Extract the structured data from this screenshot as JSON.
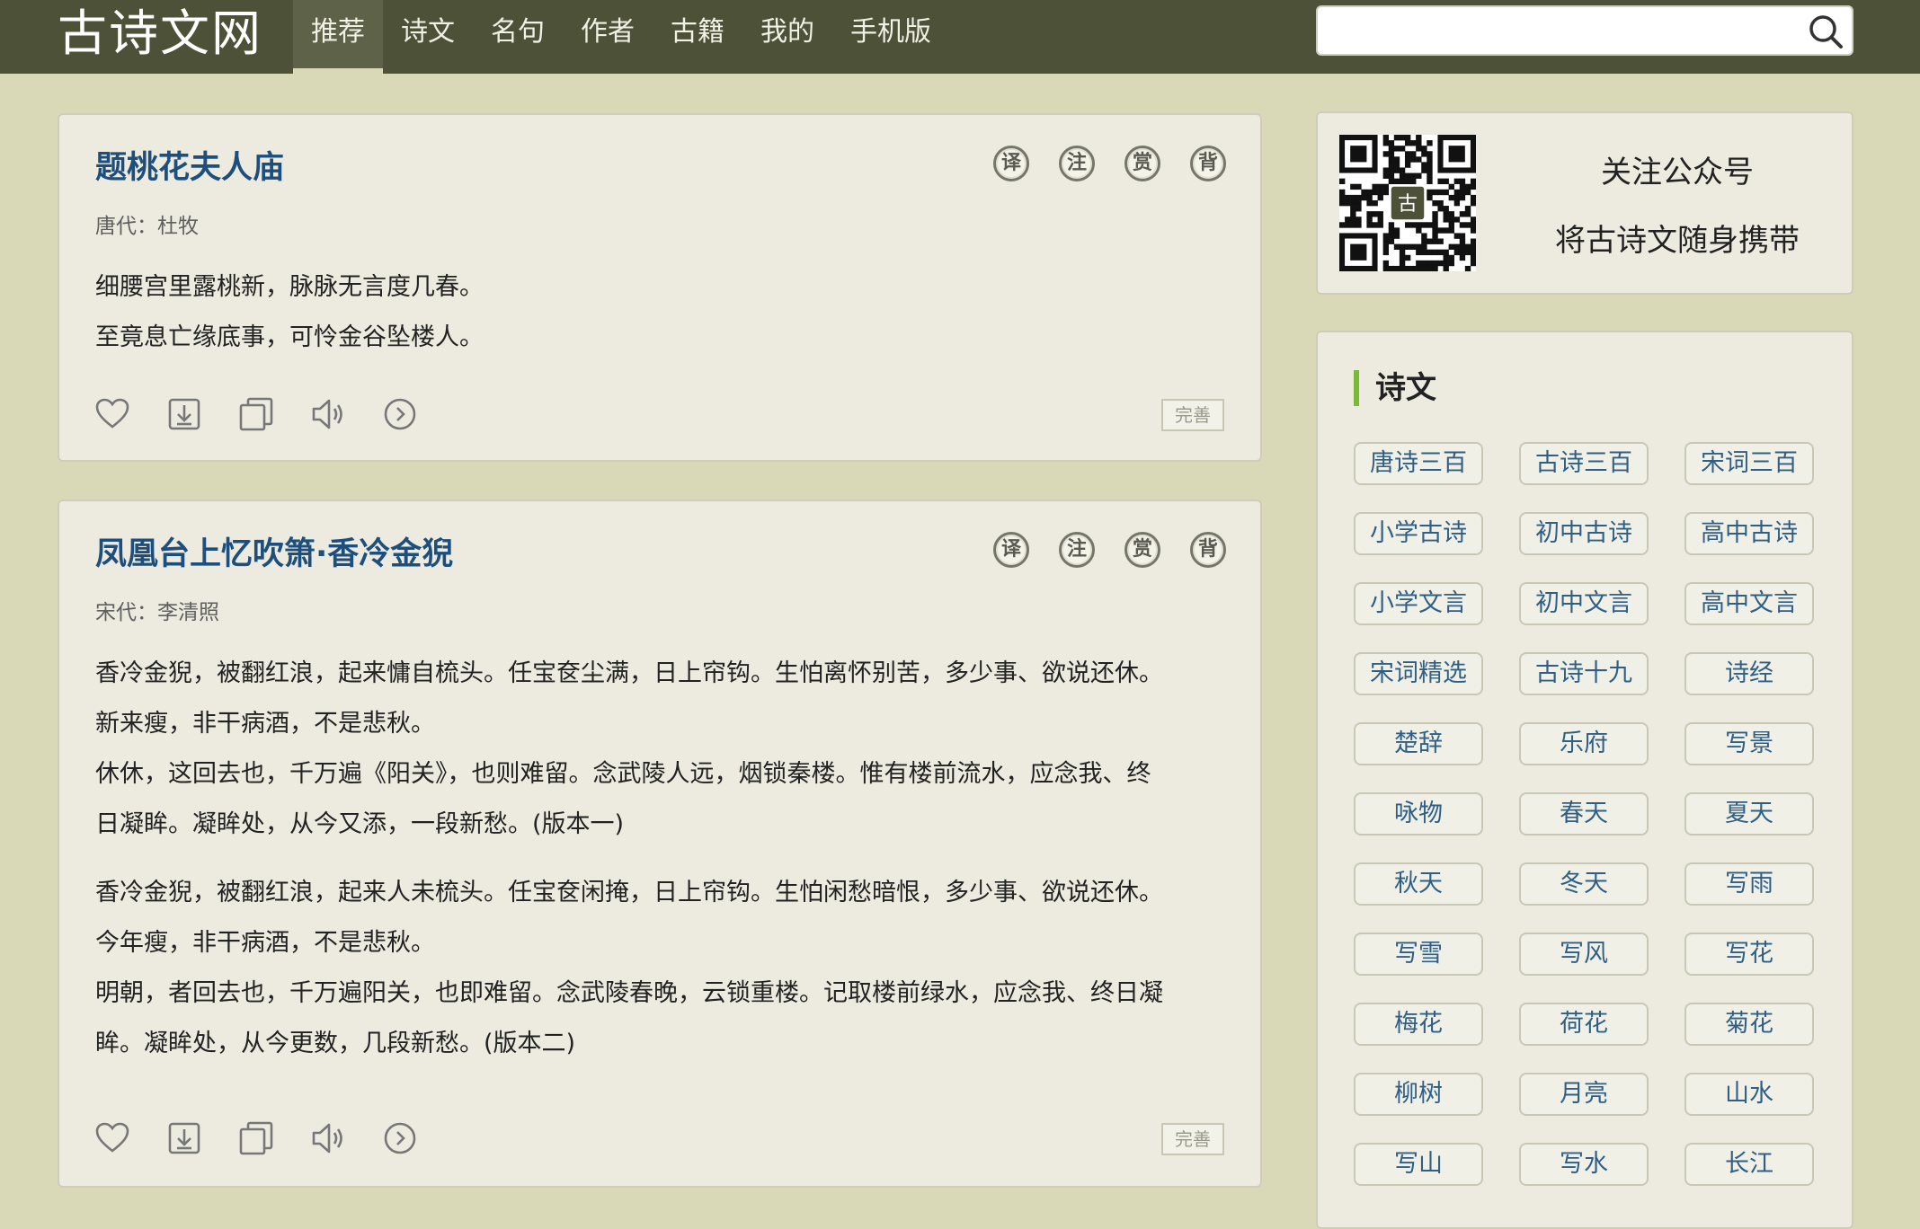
{
  "header": {
    "logo": "古诗文网",
    "nav": [
      "推荐",
      "诗文",
      "名句",
      "作者",
      "古籍",
      "我的",
      "手机版"
    ],
    "search_placeholder": ""
  },
  "poems": [
    {
      "title": "题桃花夫人庙",
      "source": "唐代：杜牧",
      "action_labels": [
        "译",
        "注",
        "赏",
        "背"
      ],
      "paragraphs": [
        [
          "细腰宫里露桃新，脉脉无言度几春。",
          "至竟息亡缘底事，可怜金谷坠楼人。"
        ]
      ],
      "wanshan": "完善"
    },
    {
      "title": "凤凰台上忆吹箫·香冷金猊",
      "source": "宋代：李清照",
      "action_labels": [
        "译",
        "注",
        "赏",
        "背"
      ],
      "paragraphs": [
        [
          "香冷金猊，被翻红浪，起来慵自梳头。任宝奁尘满，日上帘钩。生怕离怀别苦，多少事、欲说还休。",
          "新来瘦，非干病酒，不是悲秋。",
          "休休，这回去也，千万遍《阳关》，也则难留。念武陵人远，烟锁秦楼。惟有楼前流水，应念我、终",
          "日凝眸。凝眸处，从今又添，一段新愁。(版本一)"
        ],
        [
          "香冷金猊，被翻红浪，起来人未梳头。任宝奁闲掩，日上帘钩。生怕闲愁暗恨，多少事、欲说还休。",
          "今年瘦，非干病酒，不是悲秋。",
          "明朝，者回去也，千万遍阳关，也即难留。念武陵春晚，云锁重楼。记取楼前绿水，应念我、终日凝",
          "眸。凝眸处，从今更数，几段新愁。(版本二)"
        ]
      ],
      "wanshan": "完善"
    }
  ],
  "sidebar": {
    "qr_badge": "古",
    "qr_line1": "关注公众号",
    "qr_line2": "将古诗文随身携带",
    "category_title": "诗文",
    "tags": [
      "唐诗三百",
      "古诗三百",
      "宋词三百",
      "小学古诗",
      "初中古诗",
      "高中古诗",
      "小学文言",
      "初中文言",
      "高中文言",
      "宋词精选",
      "古诗十九",
      "诗经",
      "楚辞",
      "乐府",
      "写景",
      "咏物",
      "春天",
      "夏天",
      "秋天",
      "冬天",
      "写雨",
      "写雪",
      "写风",
      "写花",
      "梅花",
      "荷花",
      "菊花",
      "柳树",
      "月亮",
      "山水",
      "写山",
      "写水",
      "长江"
    ]
  },
  "colors": {
    "topbar": "#4c5137",
    "page_bg": "#dad9b7",
    "card_bg": "#edebdf",
    "title_blue": "#1c4f7e",
    "tag_blue": "#2f5f87",
    "accent_green": "#7bb83a"
  }
}
